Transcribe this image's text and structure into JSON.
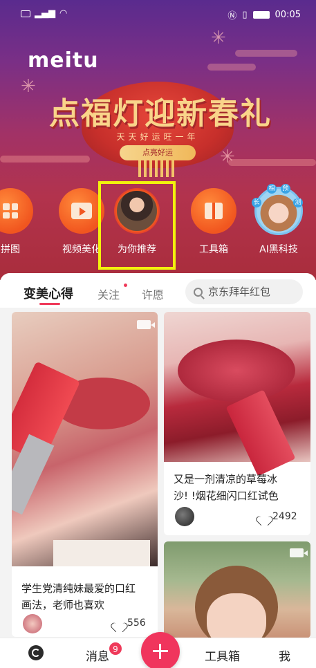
{
  "status_bar": {
    "time": "00:05",
    "left_icons": [
      "hd-icon",
      "signal-icon",
      "wifi-icon"
    ],
    "right_icons": [
      "nfc-icon",
      "vibrate-icon",
      "battery-icon"
    ]
  },
  "brand": {
    "logo": "meitu"
  },
  "promo": {
    "title": "点福灯迎新春礼",
    "subtitle": "天天好运旺一年",
    "cta": "点亮好运"
  },
  "shortcuts": [
    {
      "label": "拼图",
      "icon": "collage-icon"
    },
    {
      "label": "视频美化",
      "icon": "video-edit-icon"
    },
    {
      "label": "为你推荐",
      "icon": "recommend-avatar"
    },
    {
      "label": "工具箱",
      "icon": "toolbox-icon"
    },
    {
      "label": "AI黑科技",
      "icon": "ai-avatar",
      "badge_chars": [
        "长",
        "相",
        "预",
        "测"
      ]
    }
  ],
  "feed_tabs": [
    {
      "label": "变美心得",
      "active": true
    },
    {
      "label": "关注",
      "has_dot": true
    },
    {
      "label": "许愿"
    }
  ],
  "search": {
    "placeholder": "京东拜年红包"
  },
  "cards": [
    {
      "title_line1": "学生党清纯妹最爱的口红",
      "title_line2": "画法，老师也喜欢",
      "likes": "556",
      "is_video": true
    },
    {
      "title_line1": "又是一剂清凉的草莓冰",
      "title_line2": "沙! !烟花细闪口红试色",
      "likes": "2492",
      "is_video": false
    },
    {
      "title_line1": "",
      "title_line2": "",
      "likes": "",
      "is_video": true
    }
  ],
  "bottom_nav": {
    "messages": "消息",
    "messages_badge": "9",
    "tools": "工具箱",
    "me": "我"
  },
  "colors": {
    "accent": "#ef3a5a",
    "shortcut_orange": "#f1561f",
    "highlight": "#f2f20d"
  }
}
